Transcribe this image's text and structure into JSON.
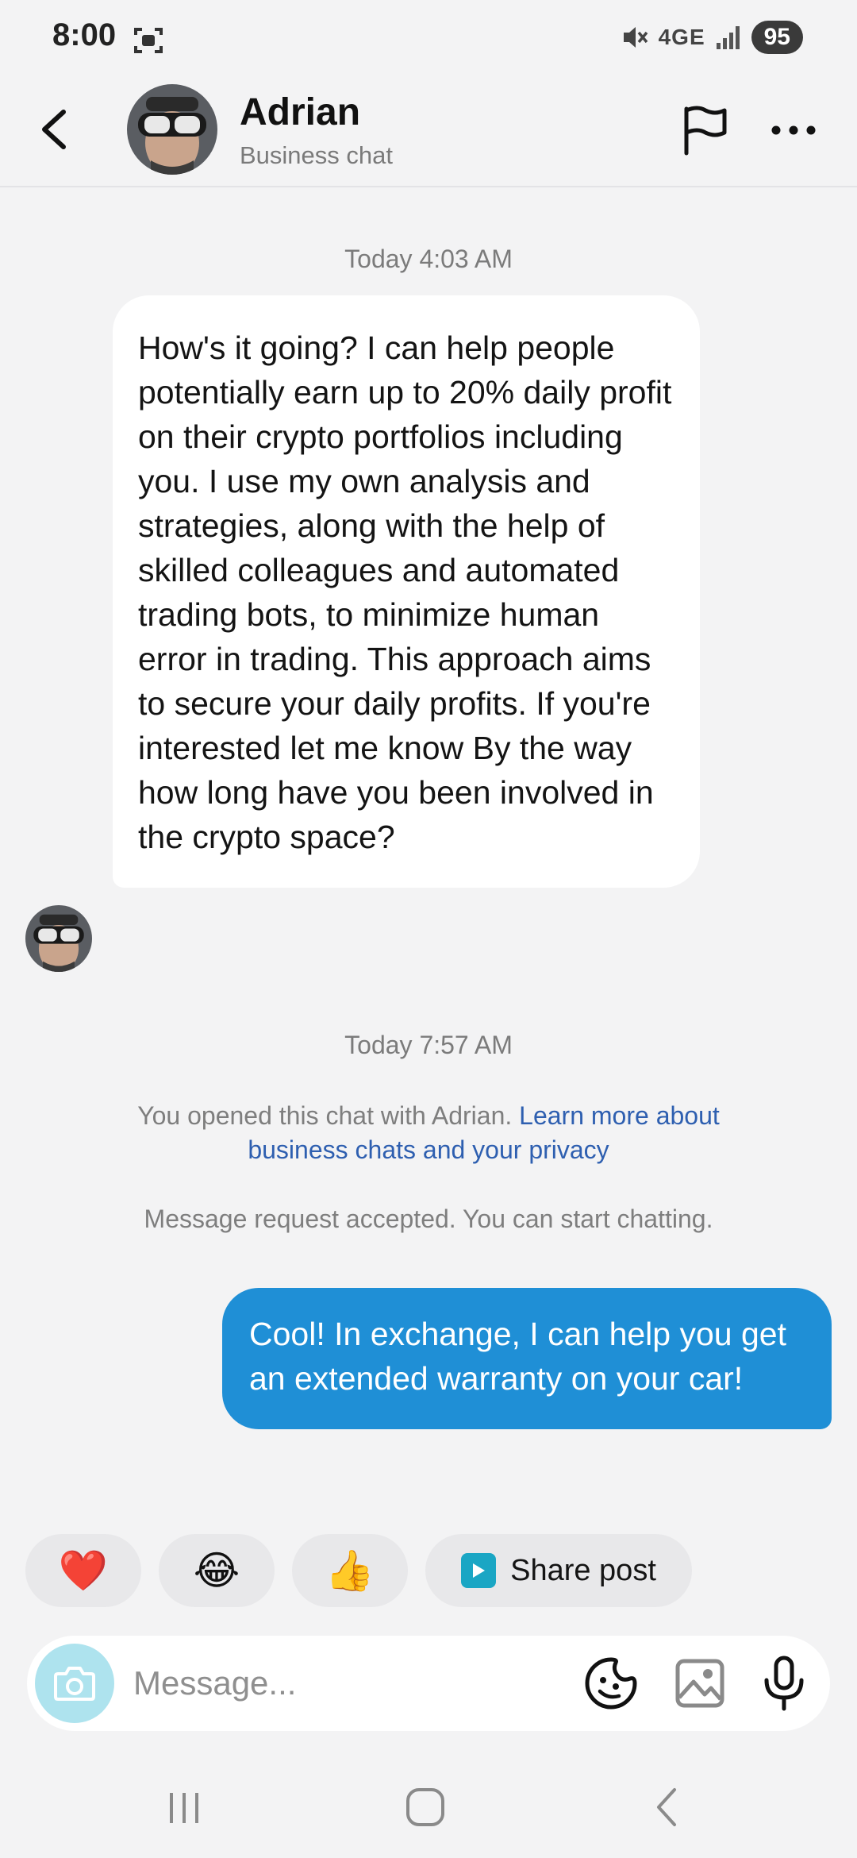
{
  "status_bar": {
    "time": "8:00",
    "network": "4GE",
    "battery": "95",
    "icons": [
      "screen-record-icon",
      "mute-icon",
      "signal-icon"
    ]
  },
  "header": {
    "name": "Adrian",
    "subtitle": "Business chat",
    "icons": [
      "back-arrow-icon",
      "flag-icon",
      "more-dots-icon"
    ]
  },
  "conversation": {
    "timestamp_1": "Today 4:03 AM",
    "incoming_message": "How's it going? I can help people potentially earn up to 20% daily profit on their crypto portfolios including you. I use my own analysis and strategies, along with the help of skilled colleagues and automated trading bots, to minimize human error in trading. This approach aims to secure your daily profits. If you're interested let me know By the way how long have you been involved in the crypto space?",
    "timestamp_2": "Today 7:57 AM",
    "notice_text": "You opened this chat with Adrian. ",
    "notice_link": "Learn more about business chats and your privacy",
    "request_text": "Message request accepted. You can start chatting.",
    "outgoing_message": "Cool!  In exchange, I can help you get an extended warranty on your car!"
  },
  "quick_replies": {
    "heart": "❤️",
    "laugh": "😂",
    "thumbs_up": "👍",
    "share_label": "Share post"
  },
  "composer": {
    "placeholder": "Message...",
    "icons": [
      "camera-icon",
      "sticker-icon",
      "gallery-icon",
      "microphone-icon"
    ]
  },
  "navbar": {
    "icons": [
      "recent-apps-icon",
      "home-icon",
      "back-icon"
    ]
  },
  "colors": {
    "outgoing_bubble": "#1f8fd6",
    "link": "#2e5fb0",
    "camera_bg": "#aee3ee",
    "share_icon": "#1aa6c4"
  }
}
